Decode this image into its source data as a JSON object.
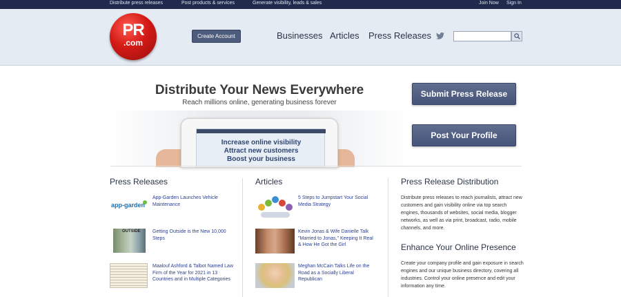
{
  "topbar": {
    "links": [
      "Distribute press releases",
      "Post products & services",
      "Generate visibility, leads & sales"
    ],
    "join": "Join Now",
    "signin": "Sign In"
  },
  "header": {
    "logo_main": "PR",
    "logo_sub": ".com",
    "create_account": "Create Account",
    "nav": [
      "Businesses",
      "Articles",
      "Press Releases"
    ],
    "search_placeholder": ""
  },
  "hero": {
    "title": "Distribute Your News Everywhere",
    "subtitle": "Reach millions online, generating business forever",
    "tablet_lines": [
      "Increase online visibility",
      "Attract new customers",
      "Boost your business"
    ],
    "submit_button": "Submit Press Release",
    "profile_button": "Post Your Profile"
  },
  "press_releases": {
    "title": "Press Releases",
    "items": [
      {
        "title": "App-Garden Launches Vehicle Maintenance",
        "thumb_text": "app-garden"
      },
      {
        "title": "Getting Outside is the New 10,000 Steps",
        "thumb_text": "OUTSIDE"
      },
      {
        "title": "Maalouf Ashford & Talbot Named Law Firm of the Year for 2021 in 13 Countries and in Multiple Categories",
        "thumb_text": ""
      }
    ]
  },
  "articles": {
    "title": "Articles",
    "items": [
      {
        "title": "5 Steps to Jumpstart Your Social Media Strategy"
      },
      {
        "title": "Kevin Jonas & Wife Danielle Talk \"Married to Jonas,\" Keeping It Real & How He Got the Girl"
      },
      {
        "title": "Meghan McCain Talks Life on the Road as a Socially Liberal Republican"
      }
    ]
  },
  "distribution": {
    "title": "Press Release Distribution",
    "text": "Distribute press releases to reach journalists, attract new customers and gain visibility online via top search engines, thousands of websites, social media, blogger networks, as well as via print, broadcast, radio, mobile channels, and more.",
    "title2": "Enhance Your Online Presence",
    "text2": "Create your company profile and gain exposure in search engines and our unique business directory, covering all industries. Control your online presence and edit your information any time."
  },
  "icons": {
    "twitter": "twitter-icon",
    "search": "search-icon"
  },
  "colors": {
    "topbar": "#1f2a4d",
    "header_bg": "#e4ebf3",
    "button": "#4d5b7c",
    "link": "#2c3f8c",
    "logo_red": "#d41a16"
  }
}
